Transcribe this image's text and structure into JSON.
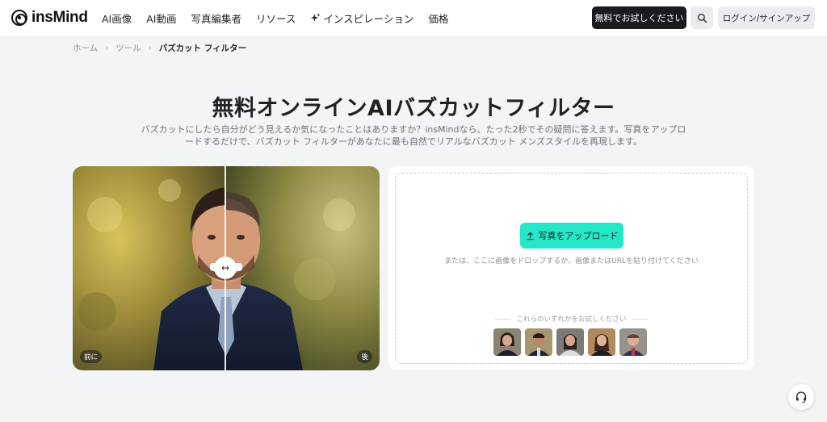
{
  "header": {
    "logo_text": "insMind",
    "nav": [
      "AI画像",
      "AI動画",
      "写真編集者",
      "リソース",
      "インスピレーション",
      "価格"
    ],
    "trial_button": "無料でお試しください",
    "login_button": "ログイン/サインアップ"
  },
  "breadcrumb": {
    "home": "ホーム",
    "tools": "ツール",
    "current": "バズカット フィルター"
  },
  "hero": {
    "title": "無料オンラインAIバズカットフィルター",
    "subtitle": "バズカットにしたら自分がどう見えるか気になったことはありますか？insMindなら、たった2秒でその疑問に答えます。写真をアップロードするだけで、バズカット フィルターがあなたに最も自然でリアルなバズカット メンズスタイルを再現します。"
  },
  "compare": {
    "before_label": "前に",
    "after_label": "後",
    "handle_glyph": "↔"
  },
  "upload": {
    "button_label": "写真をアップロード",
    "drop_hint": "または、ここに画像をドロップするか、画像またはURLを貼り付けてください",
    "try_label": "これらのいずれかをお試しください",
    "samples": [
      "sample-1",
      "sample-2",
      "sample-3",
      "sample-4",
      "sample-5"
    ]
  },
  "icons": {
    "search": "search-icon",
    "upload": "upload-icon",
    "support": "headset-icon",
    "sparkle": "sparkle-icon"
  },
  "colors": {
    "accent": "#25e6c7",
    "dark_button": "#1b1b1f",
    "page_bg": "#f3f4f6"
  }
}
